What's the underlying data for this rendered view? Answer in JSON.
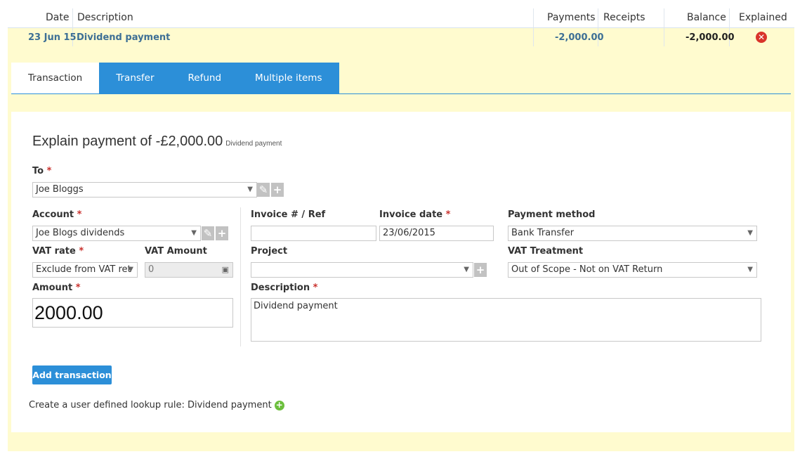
{
  "table": {
    "headers": {
      "date": "Date",
      "description": "Description",
      "payments": "Payments",
      "receipts": "Receipts",
      "balance": "Balance",
      "explained": "Explained"
    },
    "row": {
      "date": "23 Jun 15",
      "description": "Dividend payment",
      "payments": "-2,000.00",
      "receipts": "",
      "balance": "-2,000.00",
      "explained_icon": "error-circle-icon"
    }
  },
  "tabs": [
    {
      "label": "Transaction",
      "active": true
    },
    {
      "label": "Transfer",
      "active": false
    },
    {
      "label": "Refund",
      "active": false
    },
    {
      "label": "Multiple items",
      "active": false
    }
  ],
  "form": {
    "title": "Explain payment of -£2,000.00",
    "title_note": "Dividend payment",
    "to": {
      "label": "To",
      "value": "Joe Bloggs"
    },
    "account": {
      "label": "Account",
      "value": "Joe Blogs dividends"
    },
    "vat_rate": {
      "label": "VAT rate",
      "value": "Exclude from VAT ret"
    },
    "vat_amount": {
      "label": "VAT Amount",
      "value": "0"
    },
    "amount": {
      "label": "Amount",
      "value": "2000.00"
    },
    "invoice_ref": {
      "label": "Invoice # / Ref",
      "value": ""
    },
    "invoice_date": {
      "label": "Invoice date",
      "value": "23/06/2015"
    },
    "payment_method": {
      "label": "Payment method",
      "value": "Bank Transfer"
    },
    "project": {
      "label": "Project",
      "value": ""
    },
    "vat_treatment": {
      "label": "VAT Treatment",
      "value": "Out of Scope - Not on VAT Return"
    },
    "description": {
      "label": "Description",
      "value": "Dividend payment"
    },
    "required_mark": "*",
    "submit_label": "Add transaction",
    "rule_text": "Create a user defined lookup rule:",
    "rule_value": "Dividend payment"
  },
  "colors": {
    "accent": "#2c8fd8",
    "highlight_bg": "#fffbcf",
    "error": "#d9342b",
    "add": "#6cbf3d"
  }
}
